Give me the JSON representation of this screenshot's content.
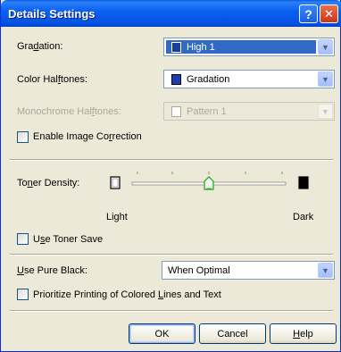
{
  "window": {
    "title": "Details Settings",
    "help_glyph": "?",
    "close_glyph": "✕"
  },
  "gradation": {
    "label_pre": "Gra",
    "label_ul": "d",
    "label_post": "ation:",
    "value": "High 1",
    "icon": "printer-quality-icon"
  },
  "color_halftones": {
    "label_pre": "Color Hal",
    "label_ul": "f",
    "label_post": "tones:",
    "value": "Gradation",
    "icon": "printer-quality-icon"
  },
  "mono_halftones": {
    "label_pre": "Monochrome Hal",
    "label_ul": "f",
    "label_post": "tones:",
    "value": "Pattern 1",
    "icon": "pattern-icon"
  },
  "image_correction": {
    "label_pre": "Enable Image Co",
    "label_ul": "r",
    "label_post": "rection",
    "checked": false
  },
  "toner_density": {
    "label_pre": "To",
    "label_ul": "n",
    "label_post": "er Density:",
    "light_label": "Light",
    "dark_label": "Dark",
    "level": 0.5
  },
  "toner_save": {
    "label_pre": "U",
    "label_ul": "s",
    "label_post": "e Toner Save",
    "checked": false
  },
  "pure_black": {
    "label_ul": "U",
    "label_post": "se Pure Black:",
    "value": "When Optimal"
  },
  "prioritize": {
    "label_pre": "Prioritize Printing of Colored ",
    "label_ul": "L",
    "label_post": "ines and Text",
    "checked": false
  },
  "buttons": {
    "ok": "OK",
    "cancel": "Cancel",
    "help_ul": "H",
    "help_post": "elp"
  },
  "colors": {
    "title_bar": "#0553e3",
    "dialog_bg": "#ece9d8",
    "selection": "#316ac5"
  }
}
